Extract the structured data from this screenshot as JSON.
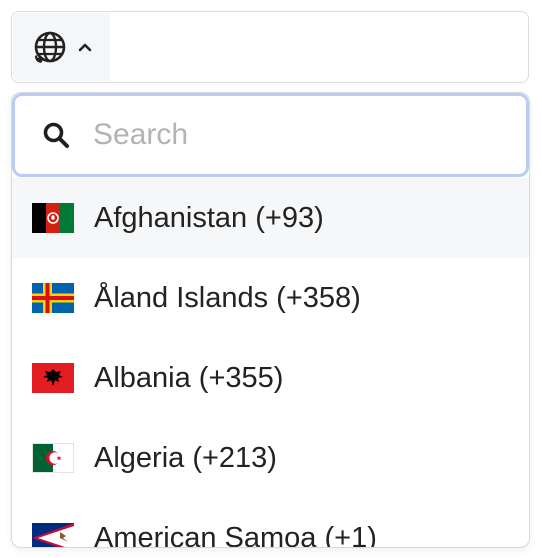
{
  "country_selector": {
    "icon": "globe-phone-icon",
    "caret_icon": "chevron-up-icon",
    "expanded": true
  },
  "search": {
    "placeholder": "Search",
    "value": "",
    "icon": "search-icon"
  },
  "countries": [
    {
      "label": "Afghanistan (+93)",
      "flag": "afghanistan-flag-icon",
      "highlighted": true
    },
    {
      "label": "Åland Islands (+358)",
      "flag": "aland-islands-flag-icon",
      "highlighted": false
    },
    {
      "label": "Albania (+355)",
      "flag": "albania-flag-icon",
      "highlighted": false
    },
    {
      "label": "Algeria (+213)",
      "flag": "algeria-flag-icon",
      "highlighted": false
    },
    {
      "label": "American Samoa (+1)",
      "flag": "american-samoa-flag-icon",
      "highlighted": false
    }
  ],
  "colors": {
    "focus_ring": "#b9cdf3",
    "highlight_row": "#f6f7f9",
    "text": "#222222",
    "placeholder": "#b3b3b3"
  }
}
